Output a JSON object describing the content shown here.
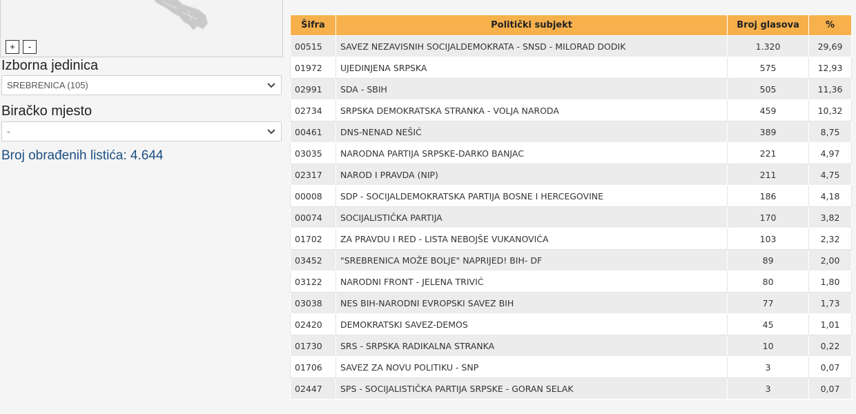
{
  "map": {
    "zoom_in_label": "+",
    "zoom_out_label": "-"
  },
  "filters": {
    "unit_label": "Izborna jedinica",
    "unit_value": "SREBRENICA (105)",
    "station_label": "Biračko mjesto",
    "station_value": "-"
  },
  "processed": "Broj obrađenih listića: 4.644",
  "table": {
    "headers": {
      "code": "Šifra",
      "subject": "Politički subjekt",
      "votes": "Broj glasova",
      "pct": "%"
    },
    "rows": [
      {
        "code": "00515",
        "subject": "SAVEZ NEZAVISNIH SOCIJALDEMOKRATA - SNSD - MILORAD DODIK",
        "votes": "1.320",
        "pct": "29,69"
      },
      {
        "code": "01972",
        "subject": "UJEDINJENA SRPSKA",
        "votes": "575",
        "pct": "12,93"
      },
      {
        "code": "02991",
        "subject": "SDA - SBIH",
        "votes": "505",
        "pct": "11,36"
      },
      {
        "code": "02734",
        "subject": "SRPSKA DEMOKRATSKA STRANKA - VOLJA NARODA",
        "votes": "459",
        "pct": "10,32"
      },
      {
        "code": "00461",
        "subject": "DNS-NENAD NEŠIĆ",
        "votes": "389",
        "pct": "8,75"
      },
      {
        "code": "03035",
        "subject": "NARODNA PARTIJA SRPSKE-DARKO BANJAC",
        "votes": "221",
        "pct": "4,97"
      },
      {
        "code": "02317",
        "subject": "NAROD I PRAVDA (NIP)",
        "votes": "211",
        "pct": "4,75"
      },
      {
        "code": "00008",
        "subject": "SDP - SOCIJALDEMOKRATSKA PARTIJA BOSNE I HERCEGOVINE",
        "votes": "186",
        "pct": "4,18"
      },
      {
        "code": "00074",
        "subject": "SOCIJALISTIČKA PARTIJA",
        "votes": "170",
        "pct": "3,82"
      },
      {
        "code": "01702",
        "subject": "ZA PRAVDU I RED - LISTA NEBOJŠE VUKANOVIĆA",
        "votes": "103",
        "pct": "2,32"
      },
      {
        "code": "03452",
        "subject": "\"SREBRENICA MOŽE BOLJE\" NAPRIJED! BIH- DF",
        "votes": "89",
        "pct": "2,00"
      },
      {
        "code": "03122",
        "subject": "NARODNI FRONT - JELENA TRIVIĆ",
        "votes": "80",
        "pct": "1,80"
      },
      {
        "code": "03038",
        "subject": "NES BIH-NARODNI EVROPSKI SAVEZ BIH",
        "votes": "77",
        "pct": "1,73"
      },
      {
        "code": "02420",
        "subject": "DEMOKRATSKI SAVEZ-DEMOS",
        "votes": "45",
        "pct": "1,01"
      },
      {
        "code": "01730",
        "subject": "SRS - SRPSKA RADIKALNA STRANKA",
        "votes": "10",
        "pct": "0,22"
      },
      {
        "code": "01706",
        "subject": "SAVEZ ZA NOVU POLITIKU - SNP",
        "votes": "3",
        "pct": "0,07"
      },
      {
        "code": "02447",
        "subject": "SPS - SOCIJALISTIČKA PARTIJA SRPSKE - GORAN SELAK",
        "votes": "3",
        "pct": "0,07"
      }
    ]
  },
  "colors": {
    "header_bg": "#f6b14d",
    "count_text": "#1c4f82",
    "map_region": "#c9c9c9"
  },
  "icons": [
    "map-region-shape",
    "chevron-down-icon"
  ]
}
